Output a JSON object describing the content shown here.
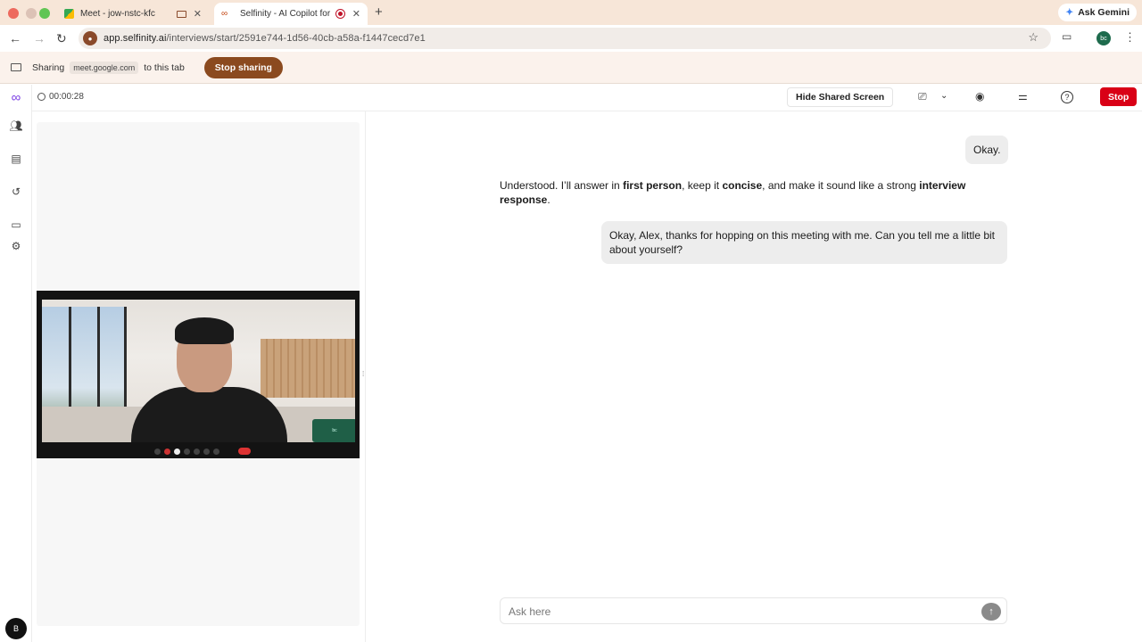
{
  "browser": {
    "tabs": [
      {
        "title": "Meet - jow-nstc-kfc",
        "active": false
      },
      {
        "title": "Selfinity - AI Copilot for In",
        "active": true
      }
    ],
    "ask_gemini": "Ask Gemini",
    "url_host": "app.selfinity.ai",
    "url_path": "/interviews/start/2591e744-1d56-40cb-a58a-f1447cecd7e1",
    "profile_initials": "bc"
  },
  "sharebar": {
    "prefix": "Sharing",
    "site": "meet.google.com",
    "suffix": "to this tab",
    "stop_label": "Stop sharing"
  },
  "app": {
    "timer": "00:00:28",
    "hide_shared_label": "Hide Shared Screen",
    "stop_label": "Stop",
    "user_avatar": "B",
    "pip_label": "bc"
  },
  "chat": {
    "msg1": "Okay.",
    "ai_parts": [
      "Understood. I’ll answer in ",
      "first person",
      ", keep it ",
      "concise",
      ", and make it sound like a strong ",
      "interview response",
      "."
    ],
    "msg2": "Okay, Alex, thanks for hopping on this meeting with me. Can you tell me a little bit about yourself?",
    "placeholder": "Ask here"
  },
  "colors": {
    "stop_red": "#d90016",
    "share_brown": "#8b4a1f",
    "tabstrip": "#f7e6d8"
  },
  "icons": [
    "back-icon",
    "forward-icon",
    "reload-icon",
    "star-icon",
    "profile-icon",
    "clock-icon",
    "screen-share-icon",
    "camera-icon",
    "settings-sliders-icon",
    "help-icon",
    "users-icon",
    "document-icon",
    "history-icon",
    "card-icon",
    "gear-icon",
    "send-icon"
  ]
}
